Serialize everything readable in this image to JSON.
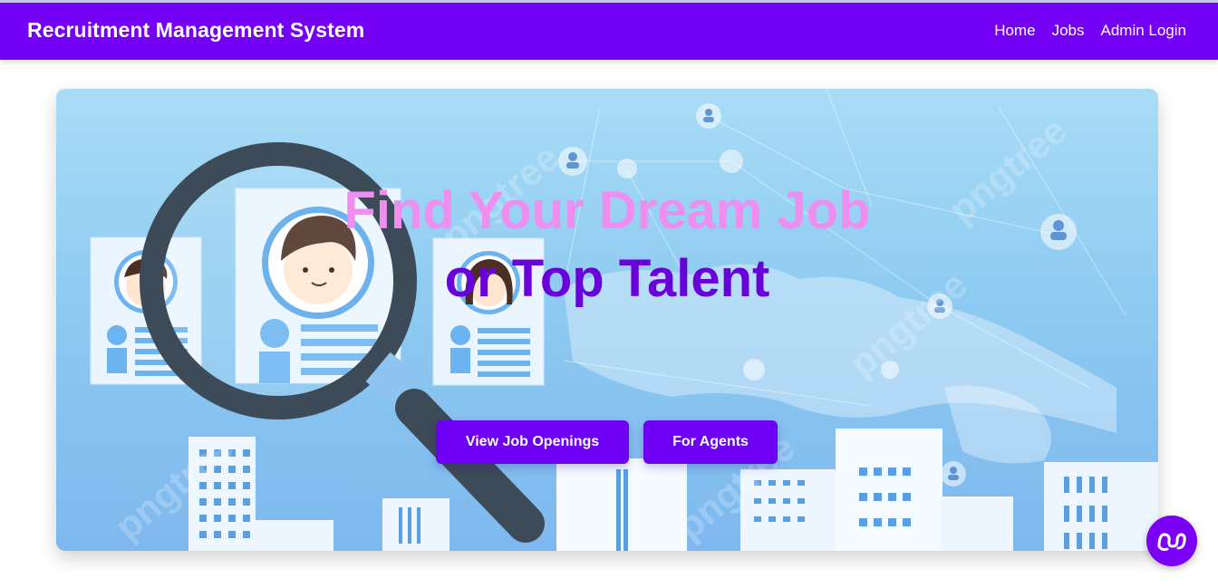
{
  "app": {
    "title": "Recruitment Management System"
  },
  "nav": {
    "links": [
      {
        "label": "Home"
      },
      {
        "label": "Jobs"
      },
      {
        "label": "Admin Login"
      }
    ]
  },
  "hero": {
    "title_line1": "Find Your Dream Job",
    "title_line2": "or Top Talent",
    "buttons": {
      "jobs_label": "View Job Openings",
      "agents_label": "For Agents"
    },
    "watermark": "pngtree"
  },
  "colors": {
    "brand": "#7400f6",
    "button": "#6d00f3",
    "title_line1": "#ee8ff0",
    "title_line2": "#6a00d9"
  },
  "icons": {
    "fab": "chat-widget-icon",
    "search": "magnifying-glass-icon"
  }
}
